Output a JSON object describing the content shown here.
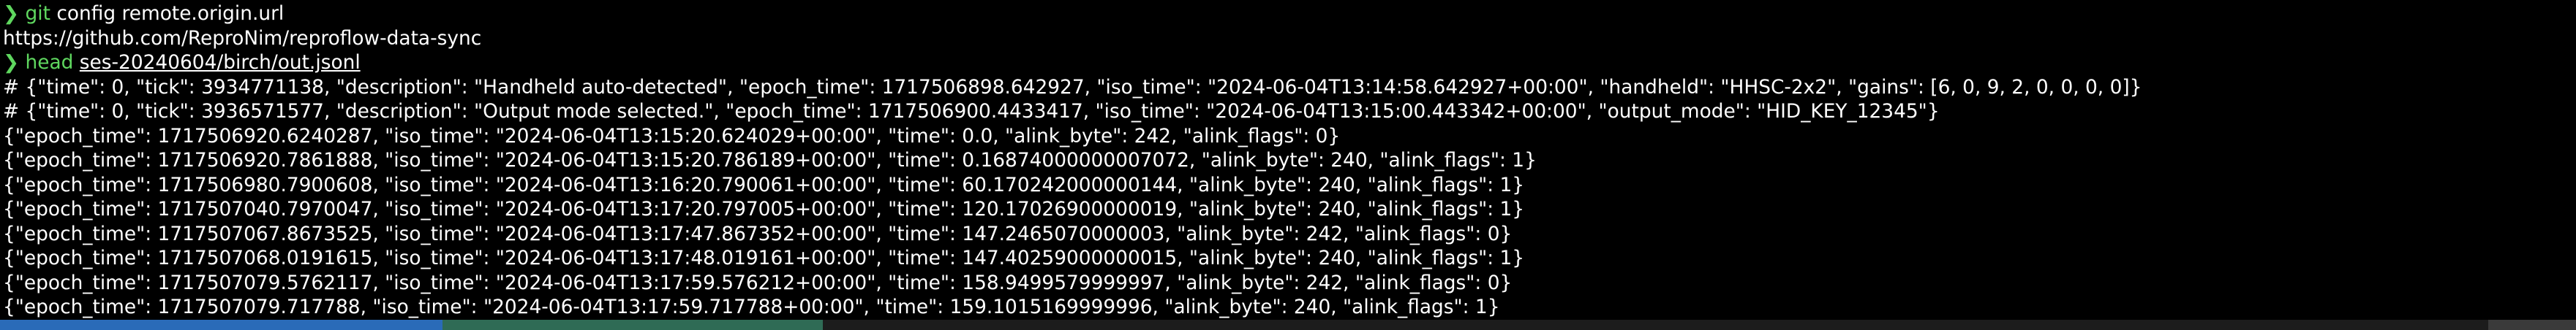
{
  "prompt": {
    "symbol": "❯",
    "color": "#5fd75f"
  },
  "commands": [
    {
      "program": "git",
      "args": "config remote.origin.url",
      "output": [
        "https://github.com/ReproNim/reproflow-data-sync"
      ]
    },
    {
      "program": "head",
      "args": "ses-20240604/birch/out.jsonl",
      "output": [
        "# {\"time\": 0, \"tick\": 3934771138, \"description\": \"Handheld auto-detected\", \"epoch_time\": 1717506898.642927, \"iso_time\": \"2024-06-04T13:14:58.642927+00:00\", \"handheld\": \"HHSC-2x2\", \"gains\": [6, 0, 9, 2, 0, 0, 0, 0]}",
        "# {\"time\": 0, \"tick\": 3936571577, \"description\": \"Output mode selected.\", \"epoch_time\": 1717506900.4433417, \"iso_time\": \"2024-06-04T13:15:00.443342+00:00\", \"output_mode\": \"HID_KEY_12345\"}",
        "{\"epoch_time\": 1717506920.6240287, \"iso_time\": \"2024-06-04T13:15:20.624029+00:00\", \"time\": 0.0, \"alink_byte\": 242, \"alink_flags\": 0}",
        "{\"epoch_time\": 1717506920.7861888, \"iso_time\": \"2024-06-04T13:15:20.786189+00:00\", \"time\": 0.16874000000007072, \"alink_byte\": 240, \"alink_flags\": 1}",
        "{\"epoch_time\": 1717506980.7900608, \"iso_time\": \"2024-06-04T13:16:20.790061+00:00\", \"time\": 60.170242000000144, \"alink_byte\": 240, \"alink_flags\": 1}",
        "{\"epoch_time\": 1717507040.7970047, \"iso_time\": \"2024-06-04T13:17:20.797005+00:00\", \"time\": 120.17026900000019, \"alink_byte\": 240, \"alink_flags\": 1}",
        "{\"epoch_time\": 1717507067.8673525, \"iso_time\": \"2024-06-04T13:17:47.867352+00:00\", \"time\": 147.2465070000003, \"alink_byte\": 242, \"alink_flags\": 0}",
        "{\"epoch_time\": 1717507068.0191615, \"iso_time\": \"2024-06-04T13:17:48.019161+00:00\", \"time\": 147.40259000000015, \"alink_byte\": 240, \"alink_flags\": 1}",
        "{\"epoch_time\": 1717507079.5762117, \"iso_time\": \"2024-06-04T13:17:59.576212+00:00\", \"time\": 158.9499579999997, \"alink_byte\": 242, \"alink_flags\": 0}",
        "{\"epoch_time\": 1717507079.717788, \"iso_time\": \"2024-06-04T13:17:59.717788+00:00\", \"time\": 159.1015169999996, \"alink_byte\": 240, \"alink_flags\": 1}"
      ]
    }
  ],
  "colors": {
    "background": "#000000",
    "foreground": "#ffffff",
    "status_bar_segment_1": "#2a6bb8",
    "status_bar_segment_2": "#2f6b55"
  }
}
